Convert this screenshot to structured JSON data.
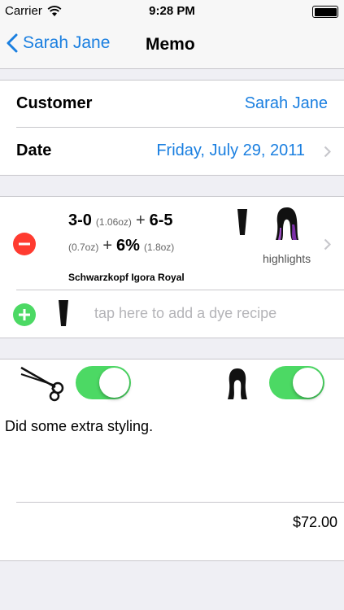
{
  "status_bar": {
    "carrier": "Carrier",
    "time": "9:28 PM"
  },
  "nav": {
    "back_label": "Sarah Jane",
    "title": "Memo"
  },
  "info": {
    "customer_label": "Customer",
    "customer_value": "Sarah Jane",
    "date_label": "Date",
    "date_value": "Friday, July 29, 2011"
  },
  "recipe": {
    "part1_shade": "3-0",
    "part1_amount": "(1.06oz)",
    "plus": "+",
    "part2_shade": "6-5",
    "part2_amount": "(0.7oz)",
    "developer": "6%",
    "developer_amount": "(1.8oz)",
    "brand": "Schwarzkopf Igora Royal",
    "style": "highlights"
  },
  "add_recipe": {
    "placeholder": "tap here to add a dye recipe"
  },
  "services": {
    "scissors_on": true,
    "style_on": true
  },
  "memo": {
    "notes": "Did some extra styling.",
    "price": "$72.00"
  },
  "colors": {
    "accent": "#1a7fe0",
    "toggle_on": "#4cd964",
    "delete_red": "#ff3b30",
    "add_green": "#4cd964"
  },
  "icons": [
    "wifi-icon",
    "battery-icon",
    "chevron-left-icon",
    "chevron-right-icon",
    "dye-tube-icon",
    "hair-highlights-icon",
    "scissors-icon",
    "hair-silhouette-icon",
    "minus-circle-icon",
    "plus-circle-icon"
  ]
}
